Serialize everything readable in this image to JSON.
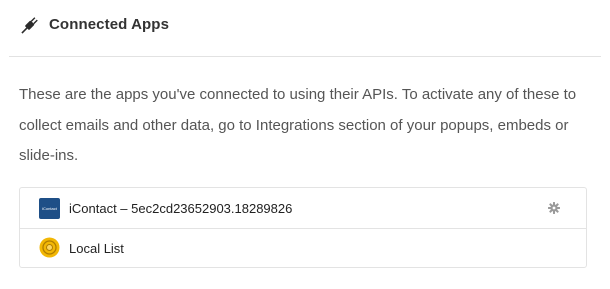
{
  "header": {
    "icon": "plug-icon",
    "title": "Connected Apps"
  },
  "description": "These are the apps you've connected to using their APIs. To activate any of these to collect emails and other data, go to Integrations section of your popups, embeds or slide-ins.",
  "apps": [
    {
      "icon": "icontact-logo",
      "logo_text": "iContact",
      "name": "iContact – 5ec2cd23652903.18289826",
      "action_icon": "gear-icon"
    },
    {
      "icon": "local-list-icon",
      "name": "Local List"
    }
  ],
  "colors": {
    "icontact_brand": "#1e4f87",
    "local_list_gold": "#f2b705"
  }
}
